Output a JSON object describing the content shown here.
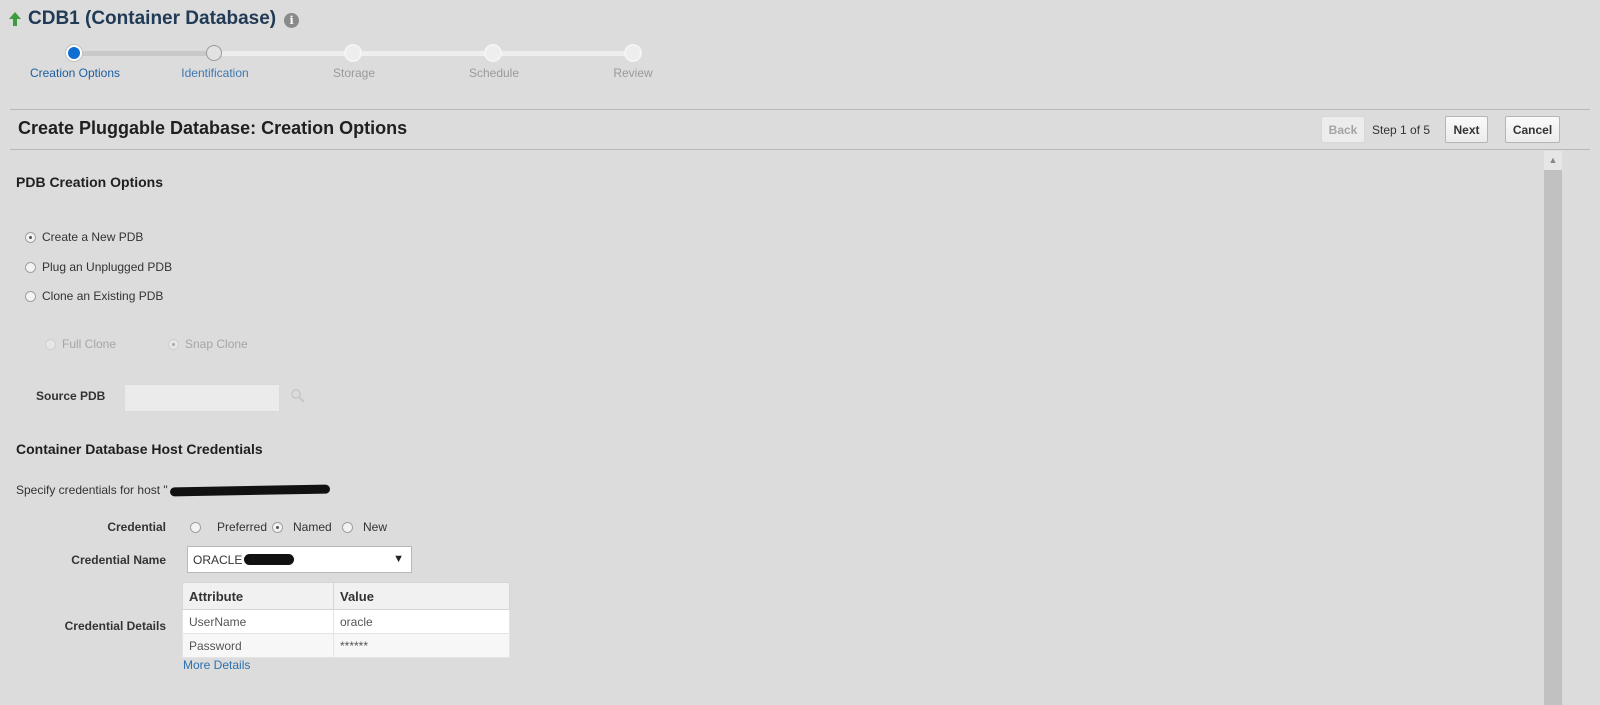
{
  "header": {
    "title": "CDB1 (Container Database)"
  },
  "train": {
    "steps": [
      {
        "label": "Creation Options",
        "state": "current"
      },
      {
        "label": "Identification",
        "state": "visited"
      },
      {
        "label": "Storage",
        "state": "unvisited"
      },
      {
        "label": "Schedule",
        "state": "unvisited"
      },
      {
        "label": "Review",
        "state": "unvisited"
      }
    ]
  },
  "page": {
    "title": "Create Pluggable Database: Creation Options",
    "back_label": "Back",
    "step_text": "Step 1 of 5",
    "next_label": "Next",
    "cancel_label": "Cancel"
  },
  "creation_options": {
    "section_title": "PDB Creation Options",
    "options": [
      {
        "label": "Create a New PDB",
        "selected": true
      },
      {
        "label": "Plug an Unplugged PDB",
        "selected": false
      },
      {
        "label": "Clone an Existing PDB",
        "selected": false
      }
    ],
    "clone_types": [
      {
        "label": "Full Clone",
        "selected": false
      },
      {
        "label": "Snap Clone",
        "selected": true
      }
    ],
    "source_pdb_label": "Source PDB",
    "source_pdb_value": ""
  },
  "credentials": {
    "section_title": "Container Database Host Credentials",
    "instructions": "Specify credentials for host \"",
    "credential_label": "Credential",
    "credential_options": [
      {
        "label": "Preferred",
        "selected": false
      },
      {
        "label": "Named",
        "selected": true
      },
      {
        "label": "New",
        "selected": false
      }
    ],
    "credential_name_label": "Credential Name",
    "credential_name_value": "ORACLE",
    "credential_details_label": "Credential Details",
    "table": {
      "columns": [
        "Attribute",
        "Value"
      ],
      "rows": [
        [
          "UserName",
          "oracle"
        ],
        [
          "Password",
          "******"
        ]
      ]
    },
    "more_details_label": "More Details"
  },
  "colors": {
    "accent": "#0f6fd1",
    "title": "#213a55",
    "link": "#2d6fae",
    "up_arrow": "#3f9b3f"
  }
}
